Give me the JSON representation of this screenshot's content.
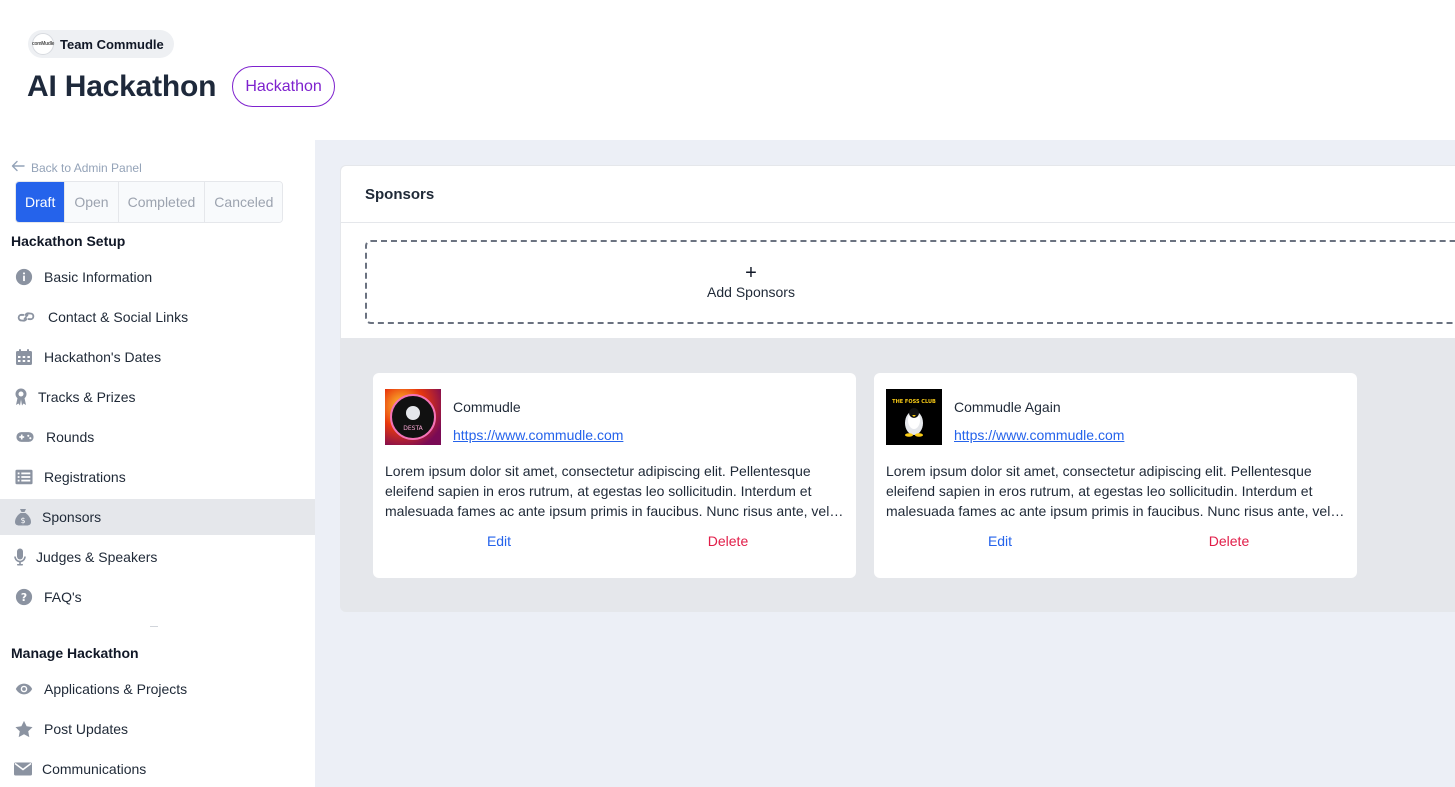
{
  "header": {
    "team_name": "Team Commudle",
    "team_logo_text": "comMudle",
    "title": "AI Hackathon",
    "badge": "Hackathon"
  },
  "sidebar": {
    "back_label": "Back to Admin Panel",
    "status_tabs": [
      "Draft",
      "Open",
      "Completed",
      "Canceled"
    ],
    "active_status": "Draft",
    "setup_heading": "Hackathon Setup",
    "setup_items": [
      {
        "label": "Basic Information",
        "icon": "info-icon"
      },
      {
        "label": "Contact & Social Links",
        "icon": "link-icon"
      },
      {
        "label": "Hackathon's Dates",
        "icon": "calendar-icon"
      },
      {
        "label": "Tracks & Prizes",
        "icon": "award-icon"
      },
      {
        "label": "Rounds",
        "icon": "gamepad-icon"
      },
      {
        "label": "Registrations",
        "icon": "list-icon"
      },
      {
        "label": "Sponsors",
        "icon": "money-bag-icon"
      },
      {
        "label": "Judges & Speakers",
        "icon": "microphone-icon"
      },
      {
        "label": "FAQ's",
        "icon": "question-icon"
      }
    ],
    "active_item": "Sponsors",
    "manage_heading": "Manage Hackathon",
    "manage_items": [
      {
        "label": "Applications & Projects",
        "icon": "eye-icon"
      },
      {
        "label": "Post Updates",
        "icon": "star-icon"
      },
      {
        "label": "Communications",
        "icon": "envelope-icon"
      }
    ]
  },
  "main": {
    "panel_title": "Sponsors",
    "add_plus": "+",
    "add_label": "Add Sponsors",
    "sponsors": [
      {
        "name": "Commudle",
        "url": "https://www.commudle.com",
        "description": "Lorem ipsum dolor sit amet, consectetur adipiscing elit. Pellentesque eleifend sapien in eros rutrum, at egestas leo sollicitudin. Interdum et malesuada fames ac ante ipsum primis in faucibus. Nunc risus ante, vel fermentum nunc.",
        "logo_text": "DESTA",
        "edit_label": "Edit",
        "delete_label": "Delete"
      },
      {
        "name": "Commudle Again",
        "url": "https://www.commudle.com",
        "description": "Lorem ipsum dolor sit amet, consectetur adipiscing elit. Pellentesque eleifend sapien in eros rutrum, at egestas leo sollicitudin. Interdum et malesuada fames ac ante ipsum primis in faucibus. Nunc risus ante, vel fermentum nunc.",
        "logo_text": "THE FOSS CLUB",
        "edit_label": "Edit",
        "delete_label": "Delete"
      }
    ]
  },
  "colors": {
    "accent": "#2563eb",
    "badge": "#7e22ce",
    "danger": "#e11d48",
    "main_bg": "#eceff6"
  }
}
